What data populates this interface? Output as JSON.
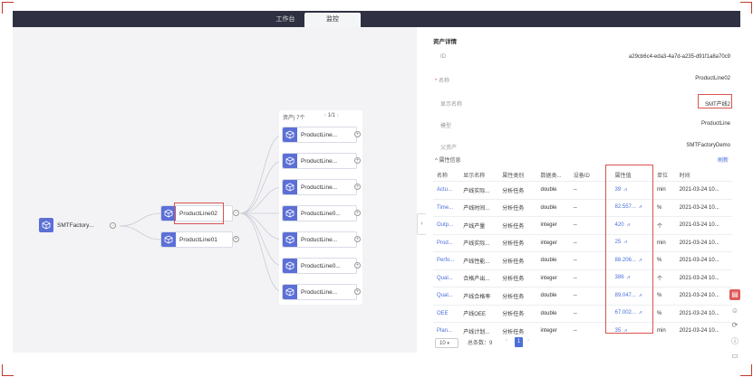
{
  "tabs": [
    {
      "label": "工作台",
      "active": false
    },
    {
      "label": "监控",
      "active": true
    }
  ],
  "tree": {
    "root": {
      "label": "SMTFactory..."
    },
    "level1": [
      {
        "label": "ProductLine02"
      },
      {
        "label": "ProductLine01"
      }
    ],
    "assets": {
      "count_label": "资产| 7个",
      "page": "1/1"
    },
    "children": [
      {
        "label": "ProductLine..."
      },
      {
        "label": "ProductLine..."
      },
      {
        "label": "ProductLine..."
      },
      {
        "label": "ProductLine0..."
      },
      {
        "label": "ProductLine..."
      },
      {
        "label": "ProductLine0..."
      },
      {
        "label": "ProductLine..."
      }
    ]
  },
  "details": {
    "title": "资产详情",
    "fields": [
      {
        "key": "ID",
        "value": "a29cb6c4-eda3-4a7d-a235-d91f1a8a70c9",
        "required": false
      },
      {
        "key": "名称",
        "value": "ProductLine02",
        "required": true
      },
      {
        "key": "显示名称",
        "value": "SMT产线2",
        "required": false
      },
      {
        "key": "模型",
        "value": "ProductLine",
        "required": false
      },
      {
        "key": "父资产",
        "value": "SMTFactoryDemo",
        "required": false
      }
    ],
    "props_title": "属性信息",
    "refresh_label": "刷新",
    "columns": [
      "名称",
      "显示名称",
      "属性类别",
      "数据类...",
      "设备ID",
      "属性值",
      "单位",
      "时间"
    ],
    "rows": [
      [
        "Actu...",
        "产线实际...",
        "分析任务",
        "double",
        "--",
        "39",
        "min",
        "2021-03-24 10..."
      ],
      [
        "Time...",
        "产线时间...",
        "分析任务",
        "double",
        "--",
        "82.557...",
        "%",
        "2021-03-24 10..."
      ],
      [
        "Outp...",
        "产线产量",
        "分析任务",
        "integer",
        "--",
        "420",
        "个",
        "2021-03-24 10..."
      ],
      [
        "Prod...",
        "产线实际...",
        "分析任务",
        "integer",
        "--",
        "25",
        "min",
        "2021-03-24 10..."
      ],
      [
        "Perfo...",
        "产线性能...",
        "分析任务",
        "double",
        "--",
        "88.206...",
        "%",
        "2021-03-24 10..."
      ],
      [
        "Qual...",
        "合格产出...",
        "分析任务",
        "integer",
        "--",
        "386",
        "个",
        "2021-03-24 10..."
      ],
      [
        "Qual...",
        "产线合格率",
        "分析任务",
        "double",
        "--",
        "89.047...",
        "%",
        "2021-03-24 10..."
      ],
      [
        "OEE",
        "产线OEE",
        "分析任务",
        "double",
        "--",
        "67.002...",
        "%",
        "2021-03-24 10..."
      ],
      [
        "Plan...",
        "产线计划...",
        "分析任务",
        "integer",
        "--",
        "35",
        "min",
        "2021-03-24 10..."
      ]
    ],
    "pager": {
      "page_size": "10",
      "total_label": "总条数：9",
      "current_page": "1"
    }
  }
}
